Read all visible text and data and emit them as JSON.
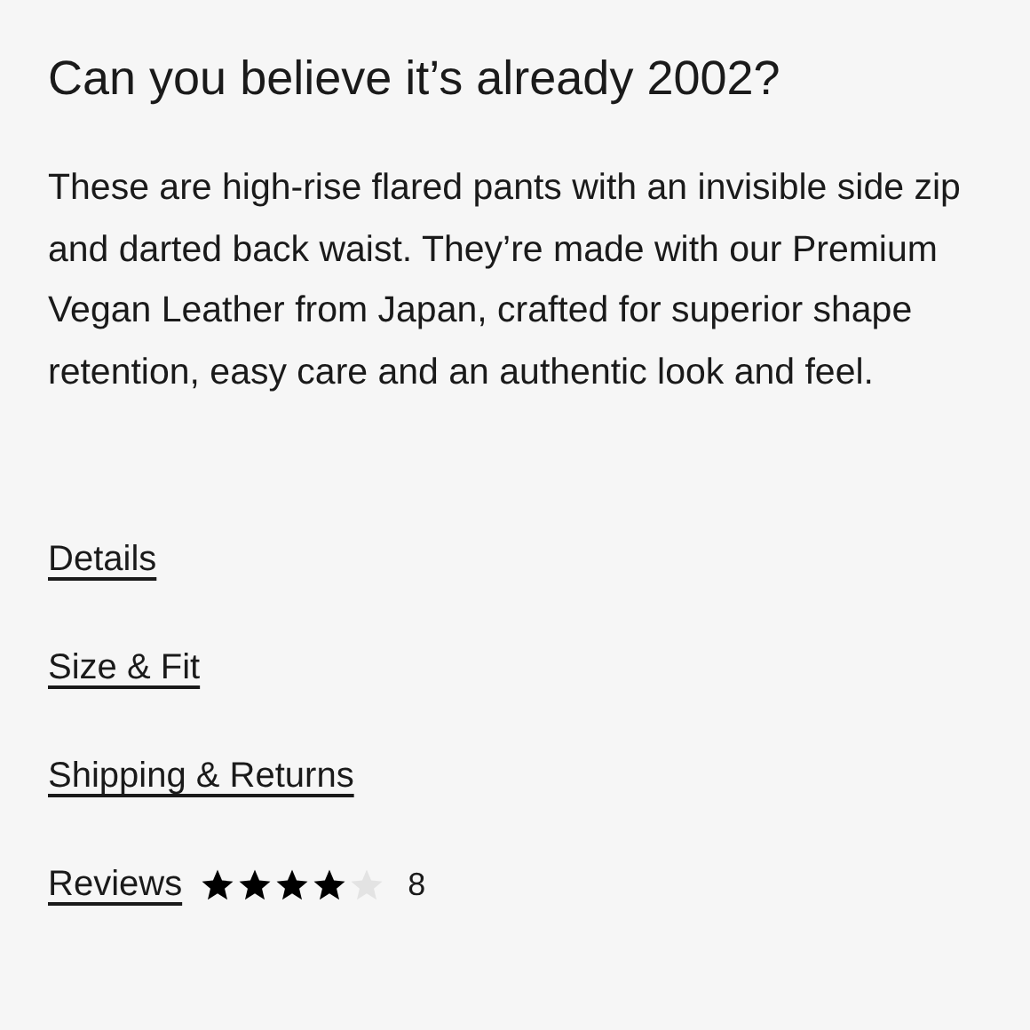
{
  "title": "Can you believe it’s already 2002?",
  "description": "These are high-rise flared pants with an invisible side zip and darted back waist. They’re made with our Premium Vegan Leather from Japan, crafted for superior shape retention, easy care and an authentic look and feel.",
  "links": [
    {
      "label": "Details"
    },
    {
      "label": "Size & Fit"
    },
    {
      "label": "Shipping & Returns"
    }
  ],
  "reviews": {
    "label": "Reviews",
    "stars": 4,
    "count": "8"
  }
}
